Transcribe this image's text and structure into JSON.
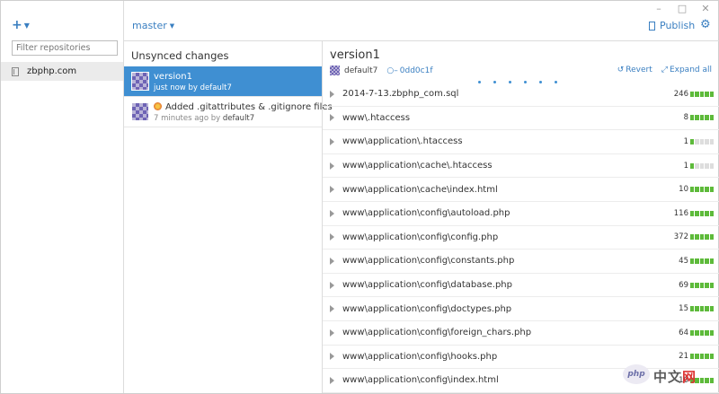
{
  "window": {
    "min_icon": "minimize-icon",
    "max_icon": "maximize-icon",
    "close_icon": "close-icon"
  },
  "sidebar": {
    "add_label": "+",
    "filter_placeholder": "Filter repositories",
    "repos": [
      {
        "name": "zbphp.com",
        "icon": "repo-icon"
      }
    ]
  },
  "header": {
    "branch": "master",
    "publish_label": "Publish",
    "settings_icon": "gear-icon"
  },
  "history": {
    "title": "Unsynced changes",
    "commits": [
      {
        "message": "version1",
        "time": "just now by",
        "author": "default7"
      },
      {
        "message": "Added .gitattributes & .gitignore files",
        "time": "7 minutes ago by",
        "author": "default7"
      }
    ]
  },
  "details": {
    "title": "version1",
    "author": "default7",
    "sha": "0dd0c1f",
    "revert_label": "Revert",
    "expand_label": "Expand all",
    "files": [
      {
        "path": "2014-7-13.zbphp_com.sql",
        "count": "246",
        "bars": 5
      },
      {
        "path": "www\\.htaccess",
        "count": "8",
        "bars": 5
      },
      {
        "path": "www\\application\\.htaccess",
        "count": "1",
        "bars": 1
      },
      {
        "path": "www\\application\\cache\\.htaccess",
        "count": "1",
        "bars": 1
      },
      {
        "path": "www\\application\\cache\\index.html",
        "count": "10",
        "bars": 5
      },
      {
        "path": "www\\application\\config\\autoload.php",
        "count": "116",
        "bars": 5
      },
      {
        "path": "www\\application\\config\\config.php",
        "count": "372",
        "bars": 5
      },
      {
        "path": "www\\application\\config\\constants.php",
        "count": "45",
        "bars": 5
      },
      {
        "path": "www\\application\\config\\database.php",
        "count": "69",
        "bars": 5
      },
      {
        "path": "www\\application\\config\\doctypes.php",
        "count": "15",
        "bars": 5
      },
      {
        "path": "www\\application\\config\\foreign_chars.php",
        "count": "64",
        "bars": 5
      },
      {
        "path": "www\\application\\config\\hooks.php",
        "count": "21",
        "bars": 5
      },
      {
        "path": "www\\application\\config\\index.html",
        "count": "10",
        "bars": 5
      }
    ]
  },
  "watermark": {
    "php": "php",
    "cn": "中文",
    "net": "网"
  },
  "colors": {
    "accent": "#3a7fc1",
    "selected": "#3f8fd2",
    "additions": "#5dba3a"
  }
}
